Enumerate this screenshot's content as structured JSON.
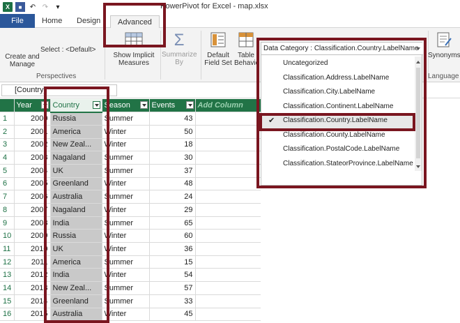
{
  "window": {
    "title": "PowerPivot for Excel - map.xlsx"
  },
  "tabs": [
    "File",
    "Home",
    "Design",
    "Advanced"
  ],
  "ribbon": {
    "create_manage": "Create and Manage",
    "select_label": "Select : <Default>",
    "perspectives_group": "Perspectives",
    "show_implicit": "Show Implicit Measures",
    "summarize_by": "Summarize By",
    "default_field_set": "Default Field Set",
    "table_behavior": "Table Behavio",
    "synonyms": "Synonyms",
    "language_group": "Language"
  },
  "formula_bar": {
    "name_box": "[Country]"
  },
  "grid": {
    "columns": [
      "Year",
      "Country",
      "Season",
      "Events",
      "Add Column"
    ],
    "rows": [
      [
        "1",
        "2000",
        "Russia",
        "Summer",
        "43"
      ],
      [
        "2",
        "2001",
        "America",
        "Winter",
        "50"
      ],
      [
        "3",
        "2002",
        "New Zeal...",
        "Winter",
        "18"
      ],
      [
        "4",
        "2003",
        "Nagaland",
        "Summer",
        "30"
      ],
      [
        "5",
        "2004",
        "UK",
        "Summer",
        "37"
      ],
      [
        "6",
        "2005",
        "Greenland",
        "Winter",
        "48"
      ],
      [
        "7",
        "2006",
        "Australia",
        "Summer",
        "24"
      ],
      [
        "8",
        "2007",
        "Nagaland",
        "Winter",
        "29"
      ],
      [
        "9",
        "2008",
        "India",
        "Summer",
        "65"
      ],
      [
        "10",
        "2009",
        "Russia",
        "Winter",
        "60"
      ],
      [
        "11",
        "2010",
        "UK",
        "Winter",
        "36"
      ],
      [
        "12",
        "2011",
        "America",
        "Summer",
        "15"
      ],
      [
        "13",
        "2012",
        "India",
        "Winter",
        "54"
      ],
      [
        "14",
        "2013",
        "New Zeal...",
        "Summer",
        "57"
      ],
      [
        "15",
        "2014",
        "Greenland",
        "Summer",
        "33"
      ],
      [
        "16",
        "2015",
        "Australia",
        "Winter",
        "45"
      ]
    ]
  },
  "data_category": {
    "selected": "Data Category : Classification.Country.LabelName",
    "options": [
      "Uncategorized",
      "Classification.Address.LabelName",
      "Classification.City.LabelName",
      "Classification.Continent.LabelName",
      "Classification.Country.LabelName",
      "Classification.County.LabelName",
      "Classification.PostalCode.LabelName",
      "Classification.StateorProvince.LabelName"
    ],
    "checked_index": 4
  },
  "colors": {
    "excel_green": "#217346",
    "file_tab_blue": "#2b579a",
    "highlight_red": "#7a1620"
  }
}
